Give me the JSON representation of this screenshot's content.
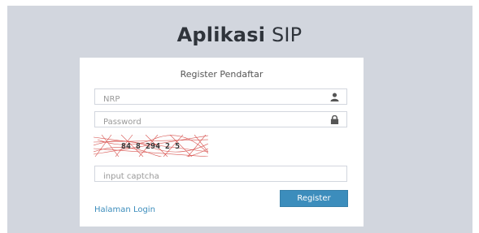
{
  "header": {
    "title_bold": "Aplikasi",
    "title_light": "SIP"
  },
  "form": {
    "message": "Register Pendaftar",
    "nrp_placeholder": "NRP",
    "nrp_value": "",
    "password_placeholder": "Password",
    "password_value": "",
    "captcha_text": "84 8 294 2 5",
    "captcha_placeholder": "input captcha",
    "captcha_value": "",
    "register_label": "Register",
    "login_link_label": "Halaman Login"
  },
  "colors": {
    "background": "#d2d6de",
    "primary": "#3c8dbc",
    "captcha_lines": "#d9534f"
  },
  "icons": {
    "nrp_field": "user-icon",
    "password_field": "lock-icon"
  }
}
